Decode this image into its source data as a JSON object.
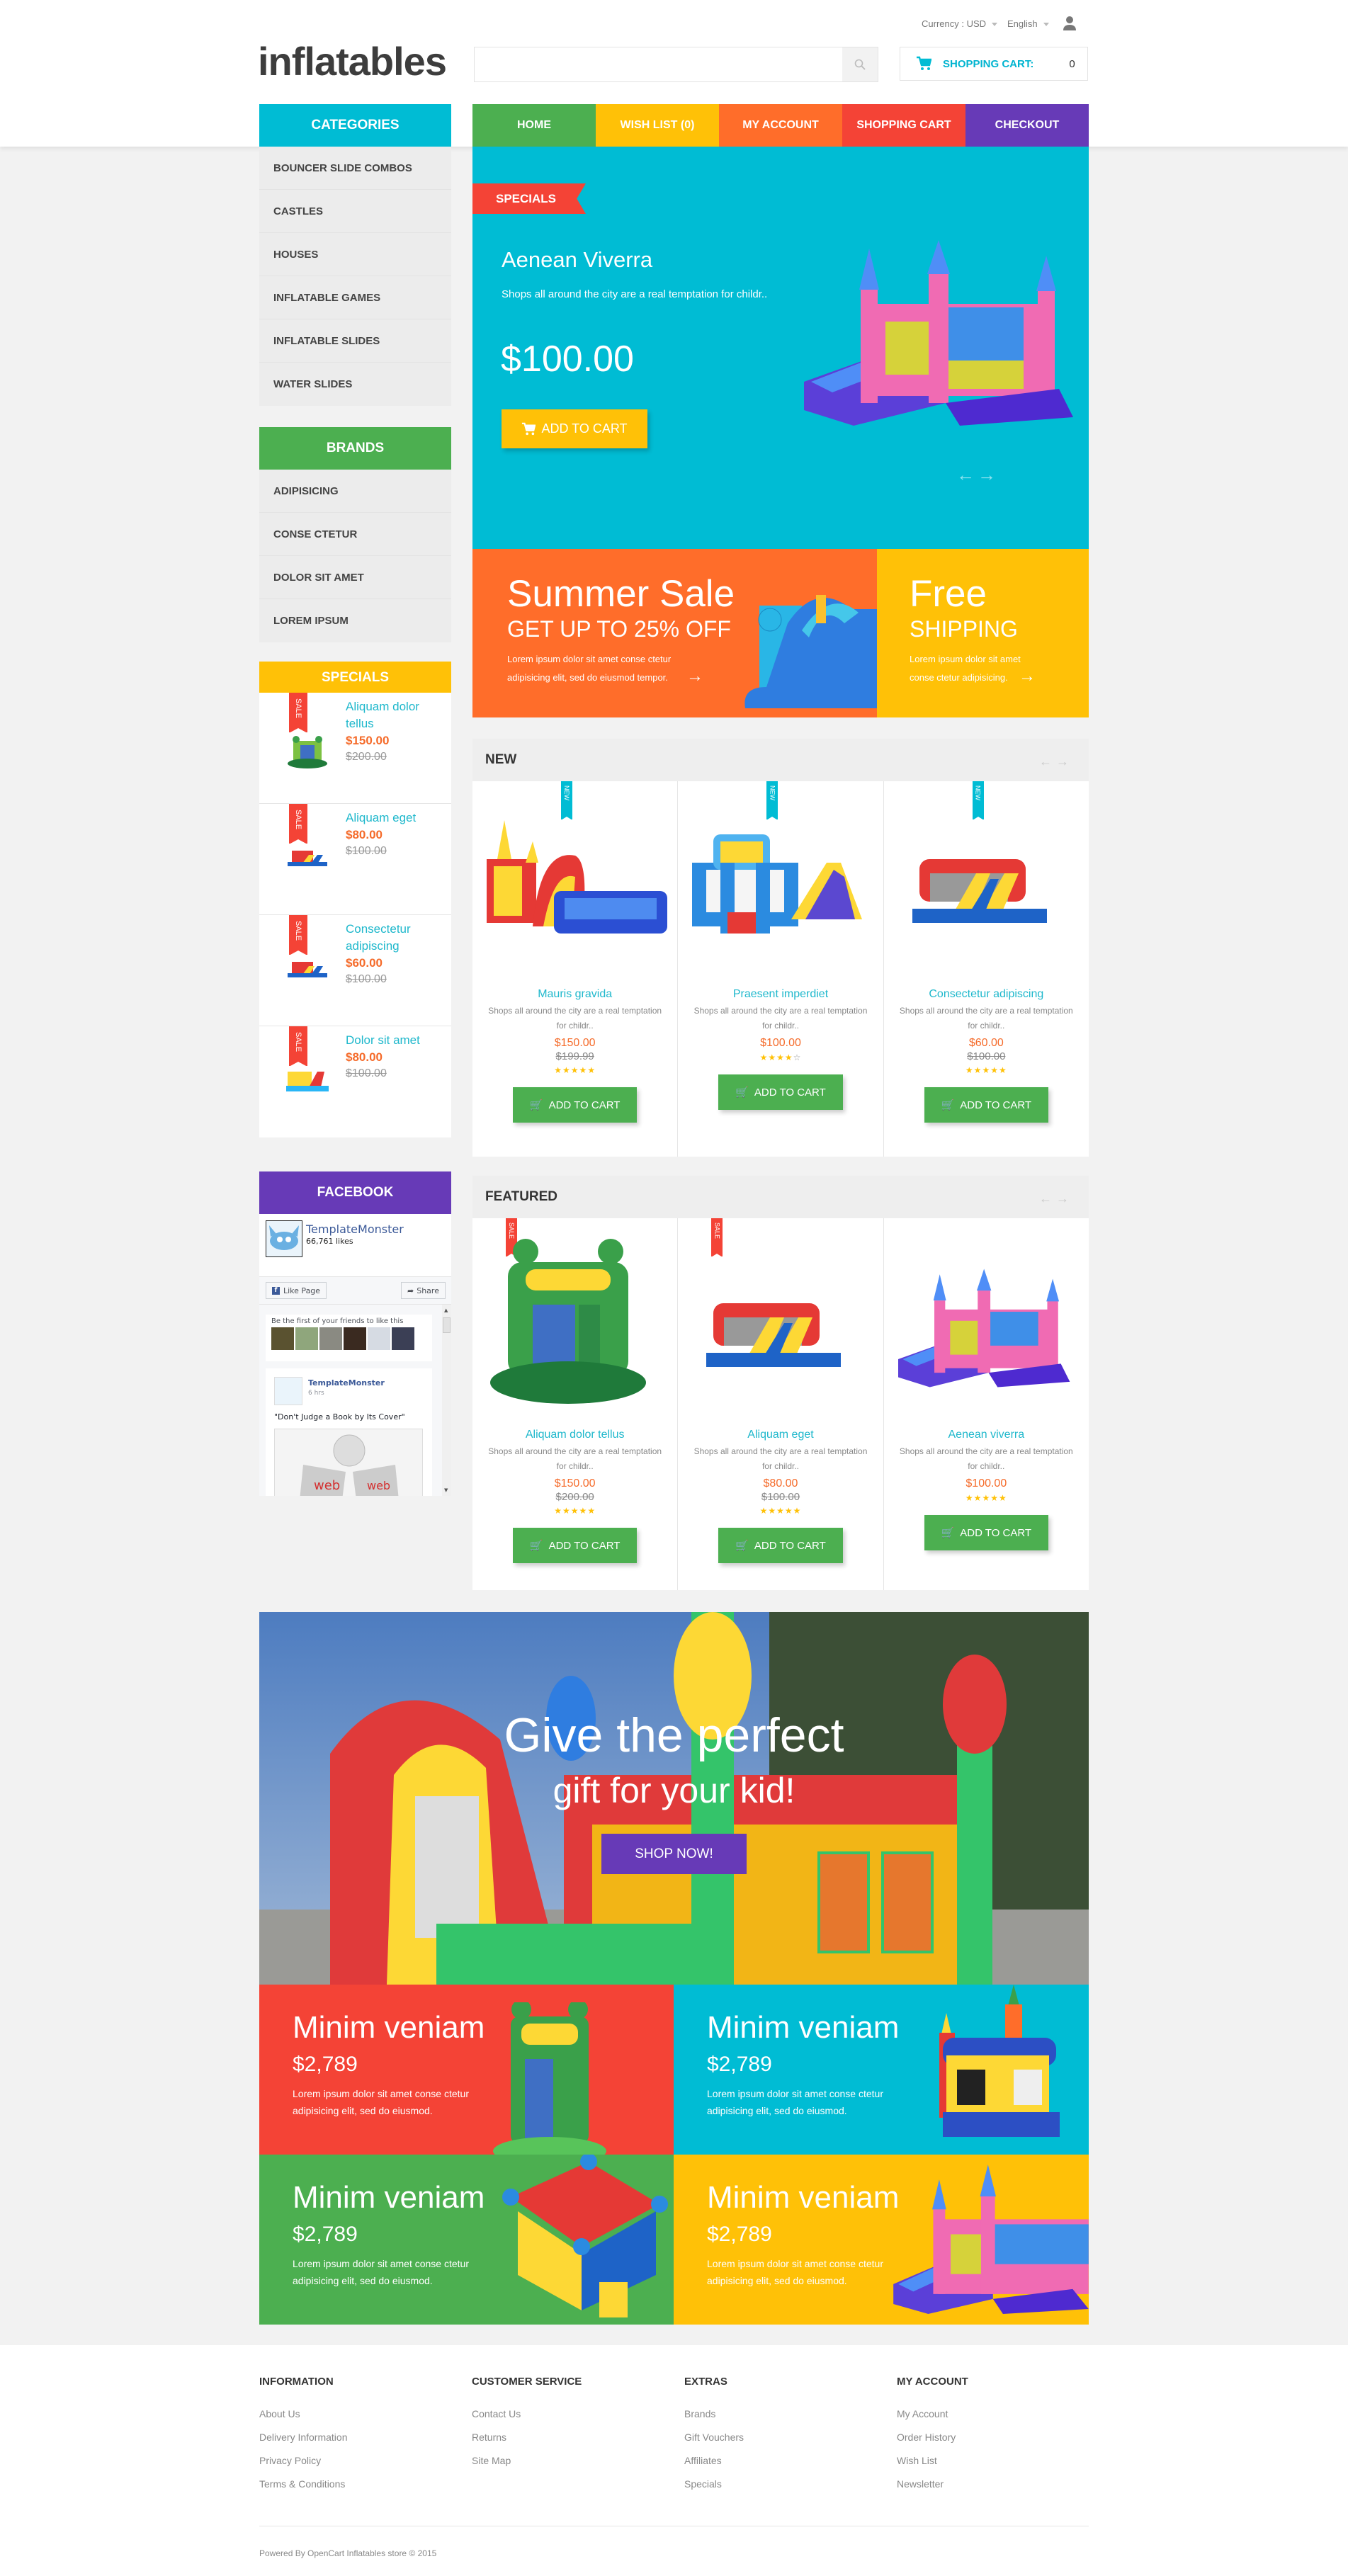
{
  "header": {
    "logo": "inflatables",
    "currency_label": "Currency : USD",
    "language_label": "English",
    "search_placeholder": "",
    "cart_label": "SHOPPING CART:",
    "cart_count": "0"
  },
  "nav": {
    "items": [
      {
        "label": "HOME",
        "color": "#4caf50"
      },
      {
        "label": "WISH LIST (0)",
        "color": "#ffc107"
      },
      {
        "label": "MY ACCOUNT",
        "color": "#ff6d2a"
      },
      {
        "label": "SHOPPING CART",
        "color": "#f44336"
      },
      {
        "label": "CHECKOUT",
        "color": "#673ab7"
      }
    ]
  },
  "sidebar": {
    "categories_title": "CATEGORIES",
    "categories": [
      "BOUNCER SLIDE COMBOS",
      "CASTLES",
      "HOUSES",
      "INFLATABLE GAMES",
      "INFLATABLE SLIDES",
      "WATER SLIDES"
    ],
    "brands_title": "BRANDS",
    "brands": [
      "ADIPISICING",
      "CONSE CTETUR",
      "DOLOR SIT AMET",
      "LOREM IPSUM"
    ],
    "specials_title": "SPECIALS",
    "specials": [
      {
        "badge": "SALE",
        "name": "Aliquam dolor tellus",
        "price": "$150.00",
        "old_price": "$200.00"
      },
      {
        "badge": "SALE",
        "name": "Aliquam eget",
        "price": "$80.00",
        "old_price": "$100.00"
      },
      {
        "badge": "SALE",
        "name": "Consectetur adipiscing",
        "price": "$60.00",
        "old_price": "$100.00"
      },
      {
        "badge": "SALE",
        "name": "Dolor sit amet",
        "price": "$80.00",
        "old_price": "$100.00"
      }
    ],
    "facebook_title": "FACEBOOK",
    "facebook": {
      "page_name": "TemplateMonster",
      "likes": "66,761 likes",
      "like_button": "Like Page",
      "share_button": "Share",
      "friends_text": "Be the first of your friends to like this",
      "post_author": "TemplateMonster",
      "post_time": "6 hrs",
      "post_text": "\"Don't Judge a Book by Its Cover\""
    }
  },
  "hero": {
    "ribbon": "SPECIALS",
    "title": "Aenean Viverra",
    "description": "Shops all around the city are a real temptation for childr..",
    "price": "$100.00",
    "button": "ADD TO CART"
  },
  "banners": {
    "sale_title": "Summer Sale",
    "sale_subtitle": "GET UP TO 25% OFF",
    "sale_text": "Lorem ipsum dolor sit amet conse ctetur adipisicing elit, sed do eiusmod tempor.",
    "ship_title": "Free",
    "ship_subtitle": "SHIPPING",
    "ship_text": "Lorem ipsum dolor sit amet conse ctetur adipisicing."
  },
  "new_products": {
    "title": "NEW",
    "items": [
      {
        "badge": "NEW",
        "name": "Mauris gravida",
        "description": "Shops all around the city are a real temptation for childr..",
        "price": "$150.00",
        "old_price": "$199.99",
        "rating": 5,
        "button": "ADD TO CART"
      },
      {
        "badge": "NEW",
        "name": "Praesent imperdiet",
        "description": "Shops all around the city are a real temptation for childr..",
        "price": "$100.00",
        "old_price": null,
        "rating": 4,
        "button": "ADD TO CART"
      },
      {
        "badge": "NEW",
        "name": "Consectetur adipiscing",
        "description": "Shops all around the city are a real temptation for childr..",
        "price": "$60.00",
        "old_price": "$100.00",
        "rating": 5,
        "button": "ADD TO CART"
      }
    ]
  },
  "featured_products": {
    "title": "FEATURED",
    "items": [
      {
        "badge": "SALE",
        "name": "Aliquam dolor tellus",
        "description": "Shops all around the city are a real temptation for childr..",
        "price": "$150.00",
        "old_price": "$200.00",
        "rating": 5,
        "button": "ADD TO CART"
      },
      {
        "badge": "SALE",
        "name": "Aliquam eget",
        "description": "Shops all around the city are a real temptation for childr..",
        "price": "$80.00",
        "old_price": "$100.00",
        "rating": 5,
        "button": "ADD TO CART"
      },
      {
        "badge": null,
        "name": "Aenean viverra",
        "description": "Shops all around the city are a real temptation for childr..",
        "price": "$100.00",
        "old_price": null,
        "rating": 5,
        "button": "ADD TO CART"
      }
    ]
  },
  "gift_banner": {
    "line1": "Give the perfect",
    "line2": "gift for your kid!",
    "button": "SHOP NOW!"
  },
  "tiles": [
    {
      "title": "Minim veniam",
      "price": "$2,789",
      "text": "Lorem ipsum dolor sit amet conse ctetur adipisicing elit, sed do eiusmod.",
      "color": "#f44336"
    },
    {
      "title": "Minim veniam",
      "price": "$2,789",
      "text": "Lorem ipsum dolor sit amet conse ctetur adipisicing elit, sed do eiusmod.",
      "color": "#00bcd4"
    },
    {
      "title": "Minim veniam",
      "price": "$2,789",
      "text": "Lorem ipsum dolor sit amet conse ctetur adipisicing elit, sed do eiusmod.",
      "color": "#4caf50"
    },
    {
      "title": "Minim veniam",
      "price": "$2,789",
      "text": "Lorem ipsum dolor sit amet conse ctetur adipisicing elit, sed do eiusmod.",
      "color": "#ffc107"
    }
  ],
  "footer": {
    "columns": [
      {
        "title": "INFORMATION",
        "links": [
          "About Us",
          "Delivery Information",
          "Privacy Policy",
          "Terms & Conditions"
        ]
      },
      {
        "title": "CUSTOMER SERVICE",
        "links": [
          "Contact Us",
          "Returns",
          "Site Map"
        ]
      },
      {
        "title": "EXTRAS",
        "links": [
          "Brands",
          "Gift Vouchers",
          "Affiliates",
          "Specials"
        ]
      },
      {
        "title": "MY ACCOUNT",
        "links": [
          "My Account",
          "Order History",
          "Wish List",
          "Newsletter"
        ]
      }
    ],
    "copyright": "Powered By OpenCart Inflatables store © 2015"
  },
  "colors": {
    "cyan": "#00bcd4",
    "green": "#4caf50",
    "yellow": "#ffc107",
    "orange": "#ff6d2a",
    "red": "#f44336",
    "purple": "#673ab7"
  }
}
